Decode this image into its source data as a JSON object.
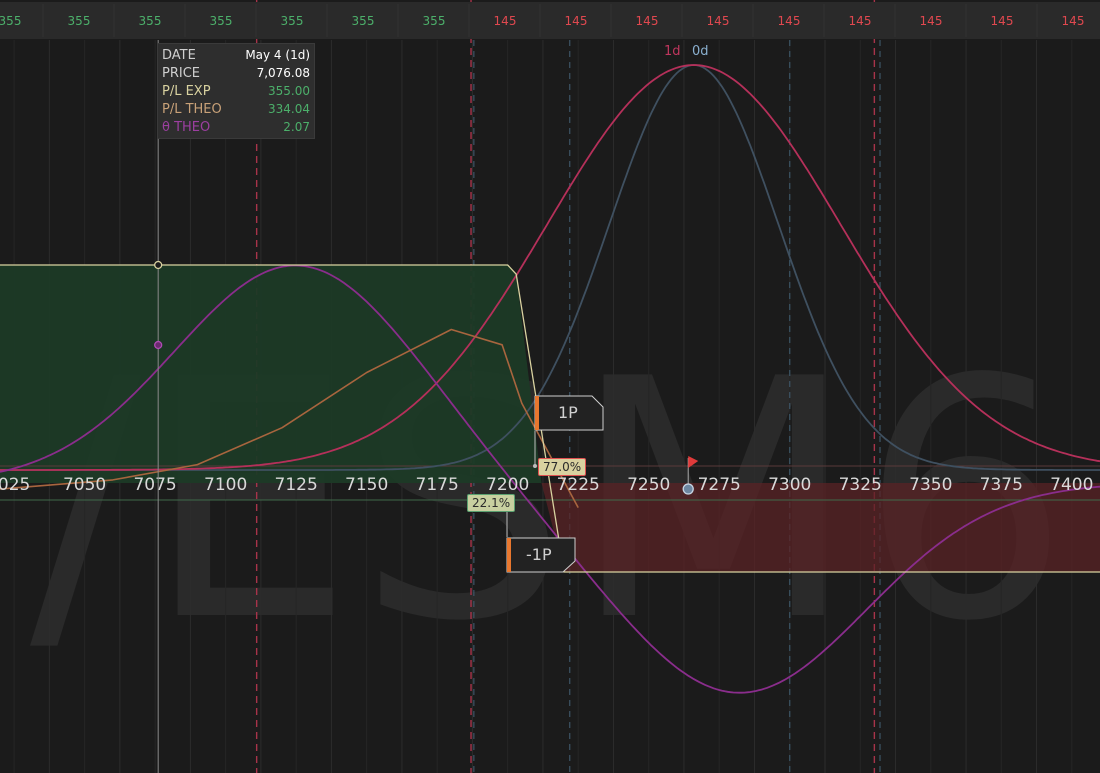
{
  "top_bar": {
    "values": [
      "355",
      "355",
      "355",
      "355",
      "355",
      "355",
      "355",
      "145",
      "145",
      "145",
      "145",
      "145",
      "145",
      "145",
      "145",
      "145"
    ],
    "positive_color": "#4caf6a",
    "negative_color": "#e0484f"
  },
  "info_box": {
    "rows": [
      {
        "key": "DATE",
        "value": "May 4 (1d)",
        "key_color": "#cfcfcf",
        "value_color": "#ffffff"
      },
      {
        "key": "PRICE",
        "value": "7,076.08",
        "key_color": "#cfcfcf",
        "value_color": "#ffffff"
      },
      {
        "key": "P/L EXP",
        "value": "355.00",
        "key_color": "#d9d2a0",
        "value_color": "#4caf6a"
      },
      {
        "key": "P/L THEO",
        "value": "334.04",
        "key_color": "#c8a178",
        "value_color": "#4caf6a"
      },
      {
        "key": "θ THEO",
        "value": "2.07",
        "key_color": "#9c3fa0",
        "value_color": "#4caf6a"
      }
    ]
  },
  "curve_labels": {
    "one_day": "1d",
    "zero_day": "0d"
  },
  "orders": {
    "long_put": "1P",
    "short_put": "-1P"
  },
  "probabilities": {
    "upper": "77.0%",
    "lower": "22.1%"
  },
  "watermark": "/ESM6",
  "chart_data": {
    "type": "line",
    "x_ticks": [
      "025",
      "7050",
      "7075",
      "7100",
      "7125",
      "7150",
      "7175",
      "7200",
      "7225",
      "7250",
      "7275",
      "7300",
      "7325",
      "7350",
      "7375",
      "7400"
    ],
    "xlim": [
      7020,
      7410
    ],
    "current_price": 7076.08,
    "marker_price": 7264,
    "reference_lines": {
      "red_dashed": [
        7111,
        7187,
        7330
      ],
      "blue_dashed": [
        7188,
        7222,
        7300,
        7332
      ]
    },
    "series": [
      {
        "kind": "pl_expiration",
        "color": "#d9d2a0",
        "points": [
          [
            7020,
            355
          ],
          [
            7200,
            355
          ],
          [
            7203,
            340
          ],
          [
            7220,
            -145
          ],
          [
            7410,
            -145
          ]
        ]
      },
      {
        "kind": "probability_1d",
        "color": "#b5305a",
        "mean": 7266,
        "sd": 52
      },
      {
        "kind": "probability_0d",
        "color": "#3f5060",
        "mean": 7266,
        "sd": 30
      },
      {
        "kind": "theta",
        "color": "#8a2d8c",
        "peak_x": 7125,
        "peak_sd": 43,
        "trough_x": 7282,
        "trough_sd": 45
      },
      {
        "kind": "pl_theo",
        "color": "#a8653e",
        "points": [
          [
            7020,
            -10
          ],
          [
            7060,
            5
          ],
          [
            7090,
            30
          ],
          [
            7120,
            90
          ],
          [
            7150,
            180
          ],
          [
            7180,
            250
          ],
          [
            7198,
            225
          ],
          [
            7205,
            130
          ],
          [
            7225,
            -40
          ]
        ]
      }
    ]
  }
}
